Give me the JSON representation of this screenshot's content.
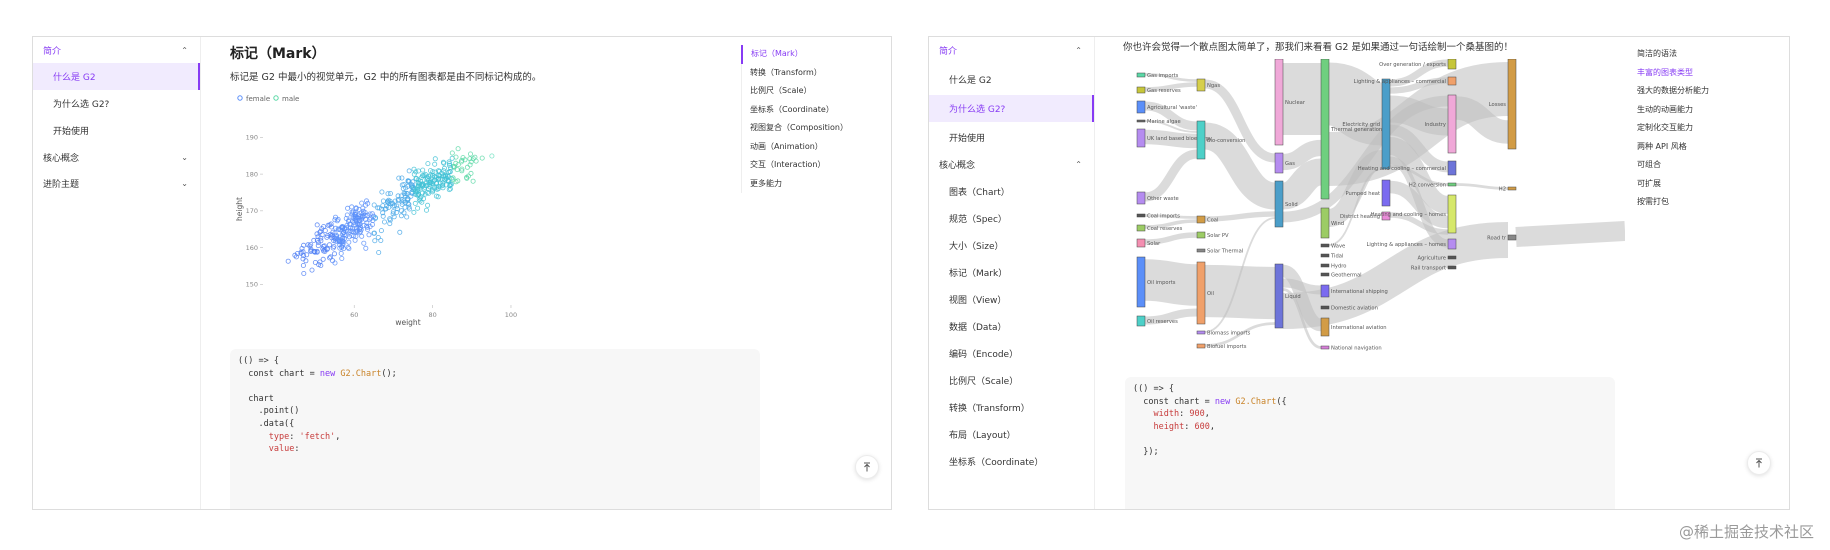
{
  "left": {
    "sidebar": {
      "groups": [
        {
          "label": "简介"
        },
        {
          "label": "核心概念"
        },
        {
          "label": "进阶主题"
        }
      ],
      "items": [
        {
          "label": "什么是 G2"
        },
        {
          "label": "为什么选 G2?"
        },
        {
          "label": "开始使用"
        }
      ]
    },
    "title": "标记（Mark）",
    "description": "标记是 G2 中最小的视觉单元，G2 中的所有图表都是由不同标记构成的。",
    "toc": [
      {
        "label": "标记（Mark）"
      },
      {
        "label": "转换（Transform）"
      },
      {
        "label": "比例尺（Scale）"
      },
      {
        "label": "坐标系（Coordinate）"
      },
      {
        "label": "视图复合（Composition）"
      },
      {
        "label": "动画（Animation）"
      },
      {
        "label": "交互（Interaction）"
      },
      {
        "label": "更多能力"
      }
    ],
    "code": {
      "l1": "(() => {",
      "l2a": "  const chart = ",
      "l2b": "new",
      "l2c": " ",
      "l2d": "G2.Chart",
      "l2e": "();",
      "l3": "  chart",
      "l4": "    .point()",
      "l5": "    .data({",
      "l6a": "      ",
      "l6b": "type",
      "l6c": ": ",
      "l6d": "'fetch'",
      "l6e": ",",
      "l7a": "      ",
      "l7b": "value",
      "l7c": ":"
    },
    "chart_data": {
      "type": "scatter",
      "xlabel": "weight",
      "ylabel": "height",
      "legend": "top-left",
      "xticks": [
        "60",
        "80",
        "100"
      ],
      "yticks": [
        "150",
        "160",
        "170",
        "180",
        "190"
      ],
      "xlim": [
        38,
        112
      ],
      "ylim": [
        146,
        195
      ],
      "colors": {
        "female": "#5b8ff9",
        "male": "#5ad8a6"
      },
      "series": [
        {
          "name": "female",
          "count": 250,
          "x_mean": 58,
          "y_mean": 164
        },
        {
          "name": "male",
          "count": 250,
          "x_mean": 78,
          "y_mean": 177
        }
      ]
    }
  },
  "right": {
    "heading": "你也许会觉得一个散点图太简单了，那我们来看看 G2 是如果通过一句话绘制一个桑基图的！",
    "sidebar": {
      "groups": [
        {
          "label": "简介"
        },
        {
          "label": "核心概念"
        }
      ],
      "items": [
        {
          "label": "什么是 G2"
        },
        {
          "label": "为什么选 G2?"
        },
        {
          "label": "开始使用"
        },
        {
          "label": "图表（Chart）"
        },
        {
          "label": "规范（Spec）"
        },
        {
          "label": "大小（Size）"
        },
        {
          "label": "标记（Mark）"
        },
        {
          "label": "视图（View）"
        },
        {
          "label": "数据（Data）"
        },
        {
          "label": "编码（Encode）"
        },
        {
          "label": "比例尺（Scale）"
        },
        {
          "label": "转换（Transform）"
        },
        {
          "label": "布局（Layout）"
        },
        {
          "label": "坐标系（Coordinate）"
        }
      ]
    },
    "toc": [
      {
        "label": "简洁的语法"
      },
      {
        "label": "丰富的图表类型"
      },
      {
        "label": "强大的数据分析能力"
      },
      {
        "label": "生动的动画能力"
      },
      {
        "label": "定制化交互能力"
      },
      {
        "label": "两种 API 风格"
      },
      {
        "label": "可组合"
      },
      {
        "label": "可扩展"
      },
      {
        "label": "按需打包"
      }
    ],
    "code": {
      "l1": "(() => {",
      "l2a": "  const chart = ",
      "l2b": "new",
      "l2c": " ",
      "l2d": "G2.Chart",
      "l2e": "({",
      "l3a": "    ",
      "l3b": "width",
      "l3c": ": ",
      "l3d": "900",
      "l3e": ",",
      "l4a": "    ",
      "l4b": "height",
      "l4c": ": ",
      "l4d": "600",
      "l4e": ",",
      "l5": "",
      "l6": "  });"
    },
    "sankey": {
      "col1": [
        {
          "label": "Gas imports",
          "color": "#5ad8a6"
        },
        {
          "label": "Gas reserves",
          "color": "#c6c63a"
        },
        {
          "label": "Agricultural 'waste'",
          "color": "#5b8ff9"
        },
        {
          "label": "Marine algae",
          "color": "#666666"
        },
        {
          "label": "UK land based bioenergy",
          "color": "#b58cf0"
        },
        {
          "label": "Other waste",
          "color": "#b58cf0"
        },
        {
          "label": "Coal imports",
          "color": "#555555"
        },
        {
          "label": "Coal reserves",
          "color": "#9ccc65"
        },
        {
          "label": "Solar",
          "color": "#f48fb1"
        },
        {
          "label": "Oil imports",
          "color": "#5b8ff9"
        },
        {
          "label": "Oil reserves",
          "color": "#4dd0c8"
        }
      ],
      "col2": [
        {
          "label": "Ngas",
          "color": "#d6cf4a"
        },
        {
          "label": "Bio-conversion",
          "color": "#4dd0c8"
        },
        {
          "label": "Coal",
          "color": "#d29c46"
        },
        {
          "label": "Solar PV",
          "color": "#9ccc65"
        },
        {
          "label": "Solar Thermal",
          "color": "#888888"
        },
        {
          "label": "Oil",
          "color": "#f0a06a"
        },
        {
          "label": "Biomass imports",
          "color": "#b58cf0"
        },
        {
          "label": "Biofuel imports",
          "color": "#f0a06a"
        }
      ],
      "col3": [
        {
          "label": "Nuclear",
          "color": "#f0a8d8"
        },
        {
          "label": "Gas",
          "color": "#b58cf0"
        },
        {
          "label": "Solid",
          "color": "#4b9ec9"
        },
        {
          "label": "Liquid",
          "color": "#6d74d9"
        }
      ],
      "col4": [
        {
          "label": "Thermal generation",
          "color": "#6fcf7f"
        },
        {
          "label": "Wind",
          "color": "#9ccc65"
        },
        {
          "label": "Wave",
          "color": "#555555"
        },
        {
          "label": "Tidal",
          "color": "#555555"
        },
        {
          "label": "Hydro",
          "color": "#555555"
        },
        {
          "label": "Geothermal",
          "color": "#555555"
        },
        {
          "label": "International shipping",
          "color": "#7b6bf0"
        },
        {
          "label": "Domestic aviation",
          "color": "#555555"
        },
        {
          "label": "International aviation",
          "color": "#d29c46"
        },
        {
          "label": "National navigation",
          "color": "#d77fd9"
        }
      ],
      "col5": [
        {
          "label": "Electricity grid",
          "color": "#4b9ec9"
        },
        {
          "label": "Pumped heat",
          "color": "#7b6bf0"
        },
        {
          "label": "District heating",
          "color": "#e98bd8"
        }
      ],
      "col6": [
        {
          "label": "Over generation / exports",
          "color": "#c6c63a"
        },
        {
          "label": "Lighting & appliances – commercial",
          "color": "#f0a06a"
        },
        {
          "label": "Industry",
          "color": "#f0a8d8"
        },
        {
          "label": "Heating and cooling – commercial",
          "color": "#6d74d9"
        },
        {
          "label": "H2 conversion",
          "color": "#6fcf7f"
        },
        {
          "label": "Heating and cooling – homes",
          "color": "#d6e86a"
        },
        {
          "label": "Lighting & appliances – homes",
          "color": "#b58cf0"
        },
        {
          "label": "Agriculture",
          "color": "#555555"
        },
        {
          "label": "Rail transport",
          "color": "#555555"
        }
      ],
      "col7": [
        {
          "label": "Losses",
          "color": "#d29c46"
        },
        {
          "label": "H2",
          "color": "#d29c46"
        },
        {
          "label": "Road tr",
          "color": "#888888"
        }
      ]
    }
  },
  "watermark": "@稀土掘金技术社区"
}
